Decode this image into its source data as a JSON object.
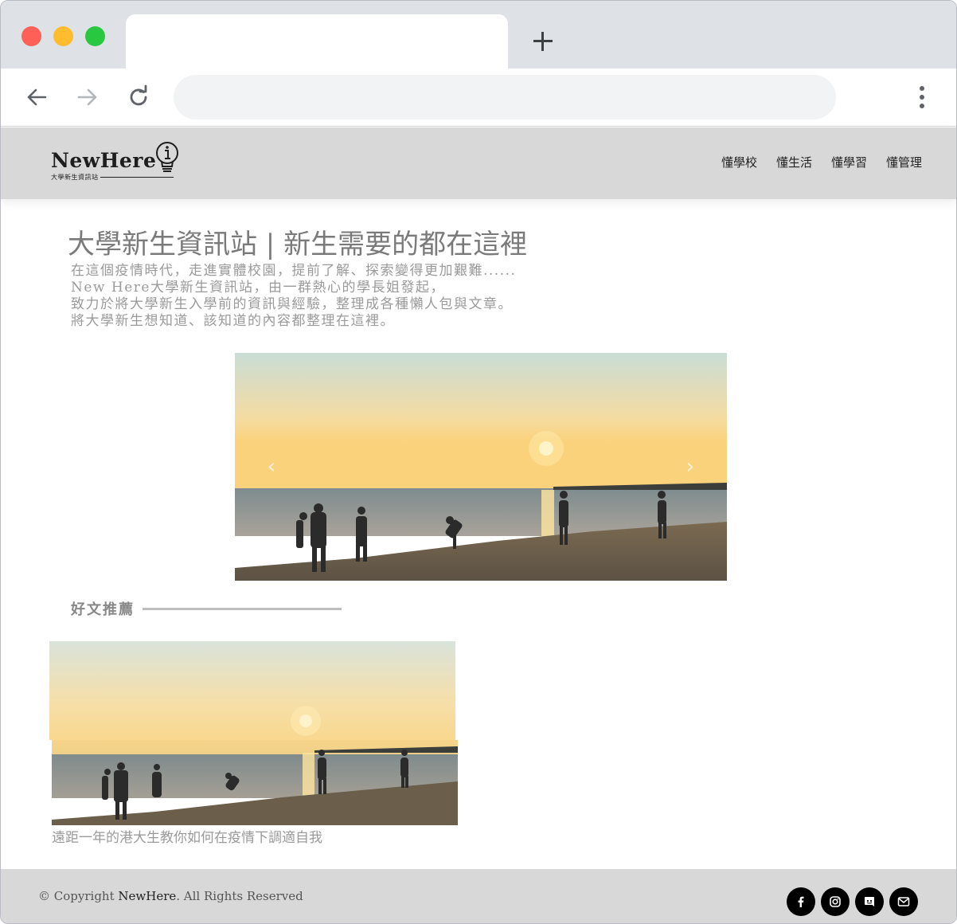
{
  "browser": {
    "tab_title": "",
    "url": ""
  },
  "site": {
    "logo_text": "NewHere",
    "logo_subtitle": "大學新生資訊站",
    "nav": [
      {
        "label": "懂學校"
      },
      {
        "label": "懂生活"
      },
      {
        "label": "懂學習"
      },
      {
        "label": "懂管理"
      }
    ]
  },
  "hero": {
    "title": "大學新生資訊站 | 新生需要的都在這裡",
    "description": [
      "在這個疫情時代，走進實體校園，提前了解、探索變得更加艱難......",
      "New Here大學新生資訊站，由一群熱心的學長姐發起，",
      "致力於將大學新生入學前的資訊與經驗，整理成各種懶人包與文章。",
      "將大學新生想知道、該知道的內容都整理在這裡。"
    ]
  },
  "carousel": {
    "prev_icon": "chevron-left-icon",
    "next_icon": "chevron-right-icon",
    "prev_glyph": "‹",
    "next_glyph": "›"
  },
  "recommended": {
    "title": "好文推薦",
    "articles": [
      {
        "caption": "遠距一年的港大生教你如何在疫情下調適自我"
      }
    ]
  },
  "footer": {
    "copyright_prefix": "© Copyright ",
    "copyright_brand": "NewHere",
    "copyright_suffix": ". All Rights Reserved",
    "socials": [
      {
        "icon": "facebook-icon"
      },
      {
        "icon": "instagram-icon"
      },
      {
        "icon": "discord-icon"
      },
      {
        "icon": "mail-icon"
      }
    ]
  },
  "colors": {
    "header_bg": "#d8d8d8",
    "footer_bg": "#d8d8d8",
    "text_muted": "#9a9a9a"
  }
}
